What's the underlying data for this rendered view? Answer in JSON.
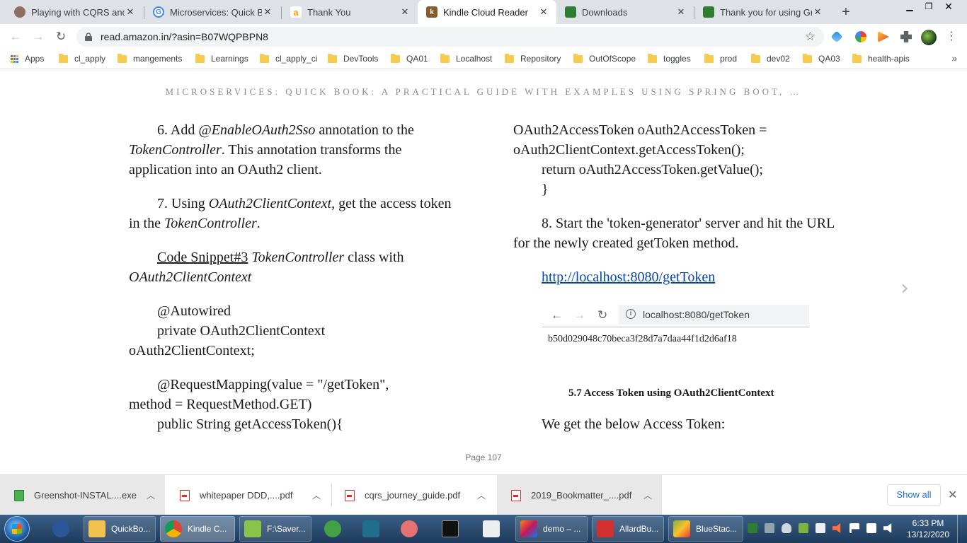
{
  "browser": {
    "tabs": [
      {
        "title": "Playing with CQRS and E",
        "icon": "avatar-favicon",
        "color": "#8d6e63"
      },
      {
        "title": "Microservices: Quick Boo",
        "icon": "google-favicon",
        "color": "#4285f4"
      },
      {
        "title": "Thank You",
        "icon": "amazon-favicon",
        "color": "#ff9900"
      },
      {
        "title": "Kindle Cloud Reader",
        "icon": "kindle-favicon",
        "color": "#8b5a2b"
      },
      {
        "title": "Downloads",
        "icon": "greenshot-favicon",
        "color": "#2e7d32"
      },
      {
        "title": "Thank you for using Gre",
        "icon": "greenshot-favicon",
        "color": "#2e7d32"
      }
    ],
    "url": "read.amazon.in/?asin=B07WQPBPN8",
    "bookmarks": [
      {
        "label": "Apps",
        "type": "apps"
      },
      {
        "label": "cl_apply",
        "type": "folder"
      },
      {
        "label": "mangements",
        "type": "folder"
      },
      {
        "label": "Learnings",
        "type": "folder"
      },
      {
        "label": "cl_apply_ci",
        "type": "folder"
      },
      {
        "label": "DevTools",
        "type": "folder"
      },
      {
        "label": "QA01",
        "type": "folder"
      },
      {
        "label": "Localhost",
        "type": "folder"
      },
      {
        "label": "Repository",
        "type": "folder"
      },
      {
        "label": "OutOfScope",
        "type": "folder"
      },
      {
        "label": "toggles",
        "type": "folder"
      },
      {
        "label": "prod",
        "type": "folder"
      },
      {
        "label": "dev02",
        "type": "folder"
      },
      {
        "label": "QA03",
        "type": "folder"
      },
      {
        "label": "health-apis",
        "type": "folder"
      }
    ]
  },
  "reader": {
    "book_title": "MICROSERVICES: QUICK BOOK: A PRACTICAL GUIDE WITH EXAMPLES USING SPRING BOOT, …",
    "left": {
      "p6_a": "6. Add ",
      "p6_b": "@EnableOAuth2Sso",
      "p6_c": " annotation to the ",
      "p6_d": "TokenController",
      "p6_e": ". This annotation transforms the application into an OAuth2 client.",
      "p7_a": "7. Using ",
      "p7_b": "OAuth2ClientContext,",
      "p7_c": " get the access token in the ",
      "p7_d": "TokenController",
      "p7_e": ".",
      "snip_a": "Code Snippet#3",
      "snip_b": " ",
      "snip_c": "TokenController",
      "snip_d": " class with ",
      "snip_e": "OAuth2ClientContext",
      "code1": "@Autowired",
      "code2": "private OAuth2ClientContext",
      "code3": "oAuth2ClientContext;",
      "code4": "@RequestMapping(value = \"/getToken\",",
      "code5": "method = RequestMethod.GET)",
      "code6": "public String getAccessToken(){"
    },
    "right": {
      "code1": "OAuth2AccessToken oAuth2AccessToken =",
      "code2": "oAuth2ClientContext.getAccessToken();",
      "code3": "return oAuth2AccessToken.getValue();",
      "code4": "}",
      "p8": "8. Start the 'token-generator' server and hit the URL for the newly created getToken method.",
      "link": "http://localhost:8080/getToken",
      "mini_url": "localhost:8080/getToken",
      "token_value": "b50d029048c70beca3f28d7a7daa44f1d2d6af18",
      "caption": "5.7 Access Token using OAuth2ClientContext",
      "below_text": "We get the below Access Token:"
    },
    "page_label": "Page 107"
  },
  "downloads": {
    "items": [
      {
        "name": "Greenshot-INSTAL....exe",
        "type": "exe"
      },
      {
        "name": "whitepaper DDD,....pdf",
        "type": "pdf"
      },
      {
        "name": "cqrs_journey_guide.pdf",
        "type": "pdf"
      },
      {
        "name": "2019_Bookmatter_....pdf",
        "type": "pdf"
      }
    ],
    "show_all": "Show all"
  },
  "taskbar": {
    "items": [
      {
        "label": "QuickBo...",
        "icon": "folder-icon",
        "color": "#f2c14e"
      },
      {
        "label": "Kindle C...",
        "icon": "chrome-icon",
        "color": "#db4437"
      },
      {
        "label": "F:\\Saver...",
        "icon": "notepad-plus-icon",
        "color": "#8bc34a"
      },
      {
        "label": "demo – ...",
        "icon": "intellij-icon",
        "color": "#c2185b"
      },
      {
        "label": "AllardBu...",
        "icon": "pdf-reader-icon",
        "color": "#d32f2f"
      },
      {
        "label": "BlueStac...",
        "icon": "bluestacks-icon",
        "color": "#7cb342"
      }
    ],
    "time": "6:33 PM",
    "date": "13/12/2020"
  }
}
